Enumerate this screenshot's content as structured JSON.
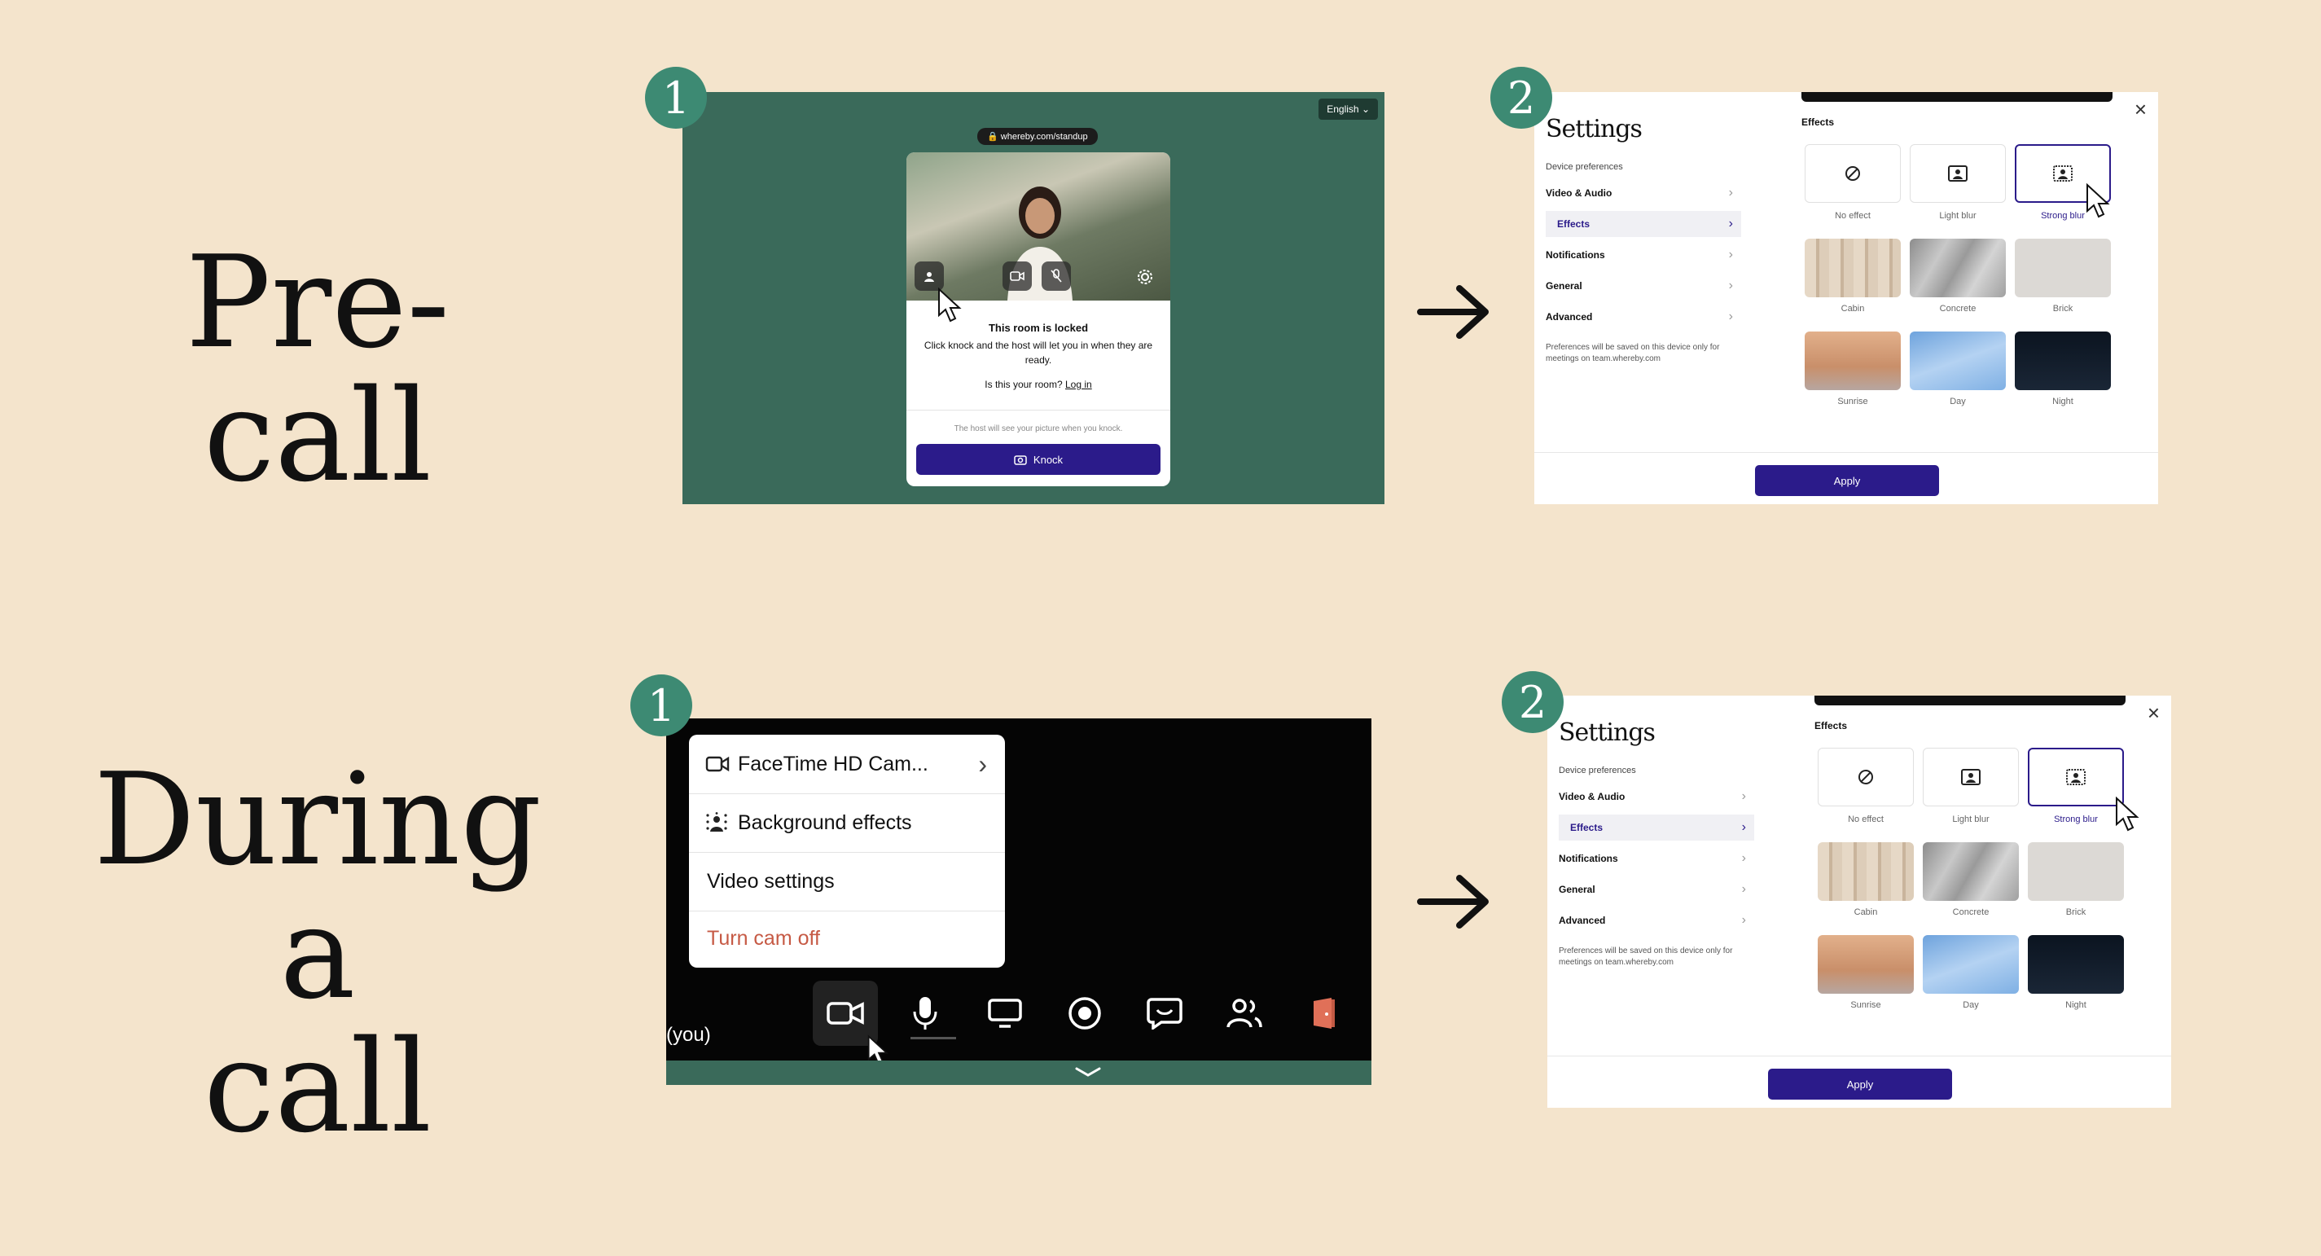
{
  "headings": {
    "pre_call": "Pre-call",
    "during_call": "During a call"
  },
  "steps": {
    "one": "1",
    "two": "2"
  },
  "pre_call_panel": {
    "language": "English",
    "url": "whereby.com/standup",
    "locked_title": "This room is locked",
    "locked_text": "Click knock and the host will let you in when they are ready.",
    "your_room_prefix": "Is this your room?",
    "login_link": "Log in",
    "host_note": "The host will see your picture when you knock.",
    "knock_button": "Knock"
  },
  "settings": {
    "title": "Settings",
    "device_preferences": "Device preferences",
    "nav": [
      {
        "label": "Video & Audio"
      },
      {
        "label": "Effects",
        "active": true
      },
      {
        "label": "Notifications"
      },
      {
        "label": "General"
      },
      {
        "label": "Advanced"
      }
    ],
    "note": "Preferences will be saved on this device only for meetings on team.whereby.com",
    "effects_heading": "Effects",
    "effects": [
      {
        "label": "No effect",
        "icon": "no-effect-icon"
      },
      {
        "label": "Light blur",
        "icon": "light-blur-icon"
      },
      {
        "label": "Strong blur",
        "icon": "strong-blur-icon",
        "selected": true
      },
      {
        "label": "Cabin",
        "color": "#d8c7b3"
      },
      {
        "label": "Concrete",
        "color": "#a9a9a9"
      },
      {
        "label": "Brick",
        "color": "#d9d6d2"
      },
      {
        "label": "Sunrise",
        "color": "#d9a07a"
      },
      {
        "label": "Day",
        "color": "#8cb7e6"
      },
      {
        "label": "Night",
        "color": "#101a2a"
      }
    ],
    "apply_button": "Apply"
  },
  "call_panel": {
    "menu": [
      {
        "label": "FaceTime HD Cam...",
        "icon": "camera-icon"
      },
      {
        "label": "Background effects",
        "icon": "background-effects-icon"
      },
      {
        "label": "Video settings"
      },
      {
        "label": "Turn cam off"
      }
    ],
    "you_label": "(you)",
    "toolbar_icons": [
      "camera-icon",
      "microphone-icon",
      "screen-share-icon",
      "record-icon",
      "chat-icon",
      "people-icon",
      "leave-icon"
    ]
  },
  "colors": {
    "background": "#f4e4cc",
    "step_badge": "#3d8a73",
    "primary": "#2b1b8a",
    "room_bg": "#3a6a5a",
    "danger": "#c65a45"
  }
}
